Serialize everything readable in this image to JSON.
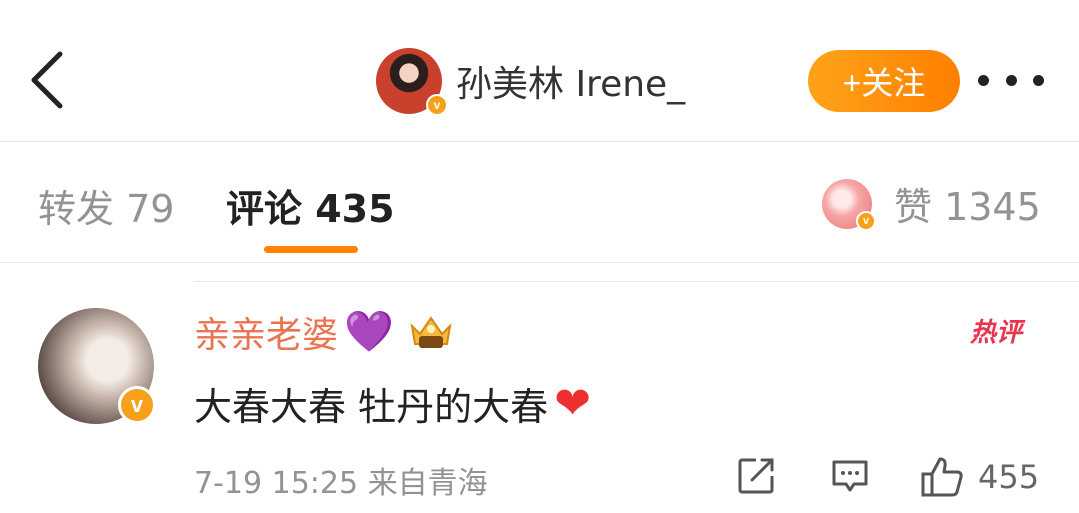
{
  "header": {
    "user_name": "孙美林 Irene_",
    "follow_label": "+关注"
  },
  "tabs": {
    "repost": "转发 79",
    "comment": "评论 435",
    "likes": "赞 1345"
  },
  "comment": {
    "author": "亲亲老婆",
    "author_heart": "💜",
    "hot_label": "热评",
    "text": "大春大春 牡丹的大春",
    "text_heart": "❤",
    "meta": "7-19 15:25 来自青海",
    "like_count": "455"
  },
  "colors": {
    "accent": "#ff8200",
    "author_name": "#eb7350",
    "hot_tag": "#e8344e",
    "verified_badge": "#f7a019"
  },
  "icons": {
    "back": "chevron-left-icon",
    "more": "more-dots-icon",
    "share": "share-icon",
    "reply": "comment-icon",
    "like": "thumbs-up-icon"
  }
}
